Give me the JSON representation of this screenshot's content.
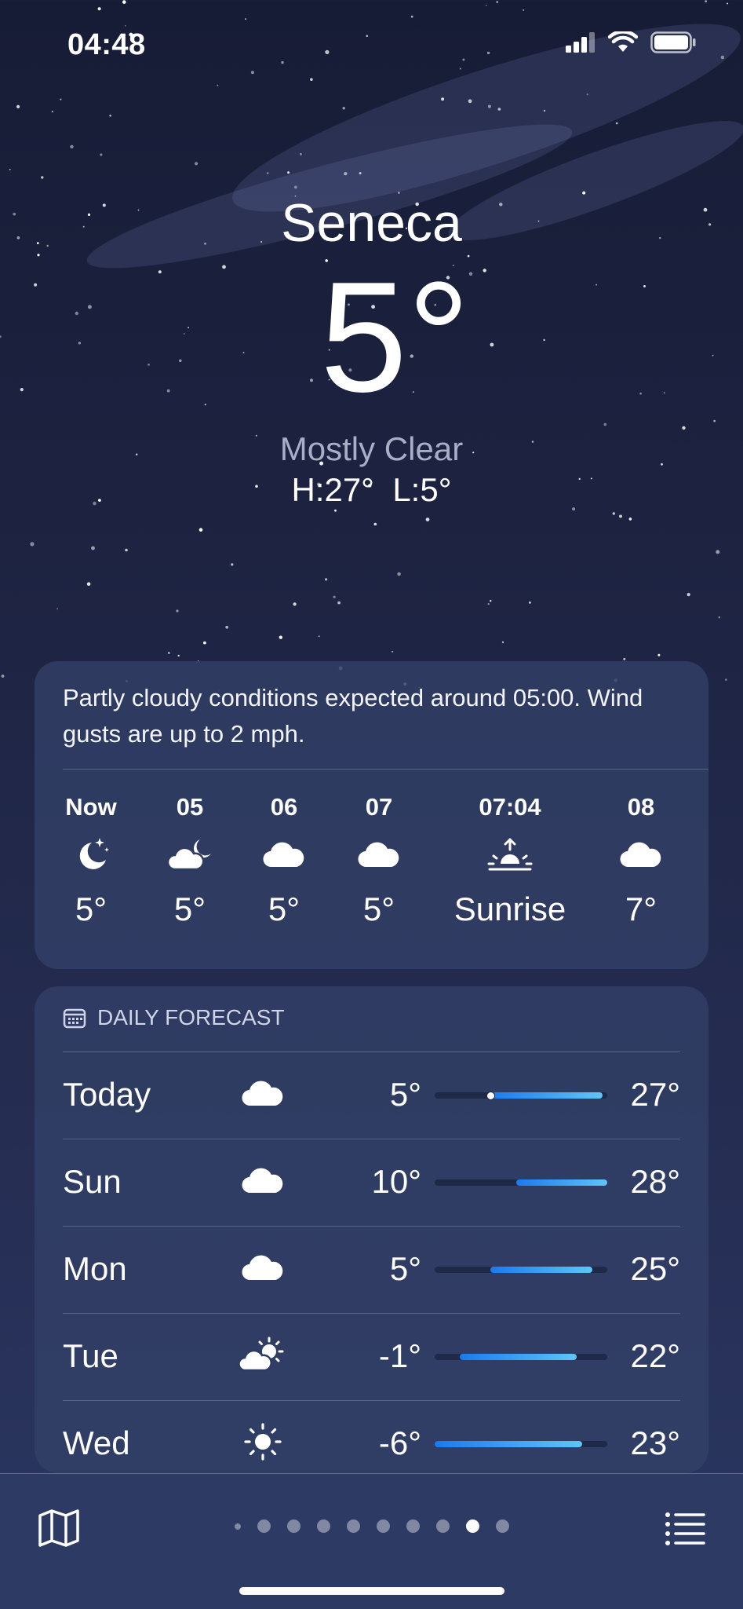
{
  "status_bar": {
    "time": "04:48"
  },
  "location": {
    "city": "Seneca",
    "temperature": "5°",
    "condition": "Mostly Clear",
    "high_low": "H:27°  L:5°"
  },
  "hourly": {
    "summary": "Partly cloudy conditions expected around 05:00. Wind gusts are up to 2 mph.",
    "items": [
      {
        "time": "Now",
        "icon": "moon-stars-icon",
        "temp": "5°"
      },
      {
        "time": "05",
        "icon": "cloud-moon-icon",
        "temp": "5°"
      },
      {
        "time": "06",
        "icon": "cloud-icon",
        "temp": "5°"
      },
      {
        "time": "07",
        "icon": "cloud-icon",
        "temp": "5°"
      },
      {
        "time": "07:04",
        "icon": "sunrise-icon",
        "temp": "Sunrise"
      },
      {
        "time": "08",
        "icon": "cloud-icon",
        "temp": "7°"
      }
    ]
  },
  "daily": {
    "title": "DAILY FORECAST",
    "range_min": -6,
    "range_max": 28,
    "days": [
      {
        "day": "Today",
        "icon": "cloud-icon",
        "low": "5°",
        "high": "27°",
        "low_value": 5,
        "high_value": 27,
        "current_value": 5
      },
      {
        "day": "Sun",
        "icon": "cloud-icon",
        "low": "10°",
        "high": "28°",
        "low_value": 10,
        "high_value": 28
      },
      {
        "day": "Mon",
        "icon": "cloud-icon",
        "low": "5°",
        "high": "25°",
        "low_value": 5,
        "high_value": 25
      },
      {
        "day": "Tue",
        "icon": "cloud-sun-icon",
        "low": "-1°",
        "high": "22°",
        "low_value": -1,
        "high_value": 22
      },
      {
        "day": "Wed",
        "icon": "sun-icon",
        "low": "-6°",
        "high": "23°",
        "low_value": -6,
        "high_value": 23
      }
    ]
  },
  "pager": {
    "page_count": 10,
    "active_page": 9
  },
  "colors": {
    "bar_cool": "#1a7af0",
    "bar_warm": "#5ec6f7"
  }
}
